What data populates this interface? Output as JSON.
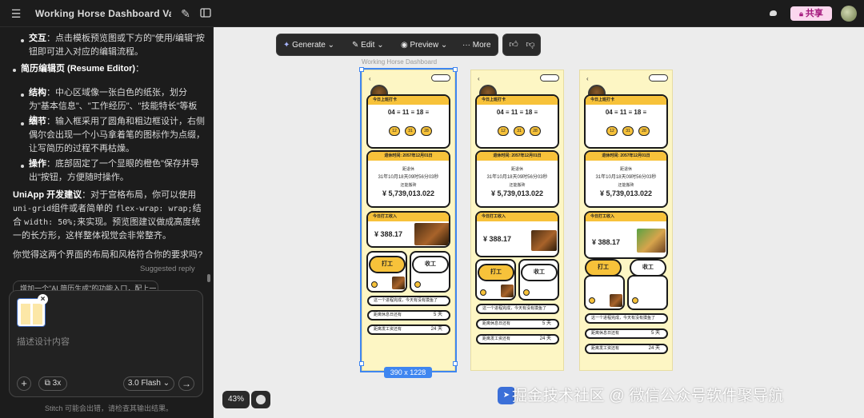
{
  "topbar": {
    "title": "Working Horse Dashboard Varian",
    "share_label": "共享"
  },
  "chat": {
    "interaction_label": "交互",
    "interaction_text": "：点击模板预览图或下方的\"使用/编辑\"按钮即可进入对应的编辑流程。",
    "resume_heading": "简历编辑页 (Resume Editor)",
    "resume_heading_suffix": "：",
    "structure_label": "结构",
    "structure_text": "：中心区域像一张白色的纸张，划分为\"基本信息\"、\"工作经历\"、\"技能特长\"等板块。",
    "detail_label": "细节",
    "detail_text": "：输入框采用了圆角和粗边框设计，右侧偶尔会出现一个小马拿着笔的图标作为点缀，让写简历的过程不再枯燥。",
    "action_label": "操作",
    "action_text": "：底部固定了一个显眼的橙色\"保存并导出\"按钮，方便随时操作。",
    "uniapp_label": "UniApp 开发建议",
    "uniapp_text_1": "：对于宫格布局，你可以使用",
    "uniapp_code_1": "uni-grid",
    "uniapp_text_2": "组件或者简单的",
    "uniapp_code_2": "flex-wrap: wrap;",
    "uniapp_text_3": "结合",
    "uniapp_code_3": "width: 50%;",
    "uniapp_text_4": "来实现。预览图建议做成高度统一的长方形，这样整体视觉会非常整齐。",
    "question": "你觉得这两个界面的布局和风格符合你的要求吗?",
    "suggested_label": "Suggested reply",
    "suggested_chip": "增加一个\"AI 简历生成\"的功能入口，配上一"
  },
  "input": {
    "placeholder": "描述设计内容",
    "multiplier": "3x",
    "model": "3.0 Flash",
    "footer_note": "Stitch 可能会出错，请检查其输出结果。"
  },
  "toolbar": {
    "generate": "Generate",
    "edit": "Edit",
    "preview": "Preview",
    "more": "More"
  },
  "canvas": {
    "frame_label": "Working Horse Dashboard",
    "dimensions": "390 x 1228",
    "zoom": "43%"
  },
  "phone": {
    "work_card": "今日上班打卡",
    "date": "04 ≡ 11 ≡ 18 ≡",
    "pill_1": "12",
    "pill_2": "31",
    "pill_3": "28",
    "elapsed_header": "退休时间: 2057年12月01日",
    "elapsed_label": "距退休",
    "elapsed_value": "31年10月18天09时56分03秒",
    "salary_label": "还能搬砖",
    "salary_value": "¥ 5,739,013.022",
    "income_header": "今日打工收入",
    "income_value": "¥ 388.17",
    "clock_in": "打工",
    "clock_out": "收工",
    "row_1": "这一个进程完成，今天有没有摸鱼了",
    "row_2": "距离休息日还有",
    "row_2_val": "5 天",
    "row_3": "距离发工资还有",
    "row_3_val": "24 天"
  },
  "watermark": "掘金技术社区 @ 微信公众号软件聚导航"
}
